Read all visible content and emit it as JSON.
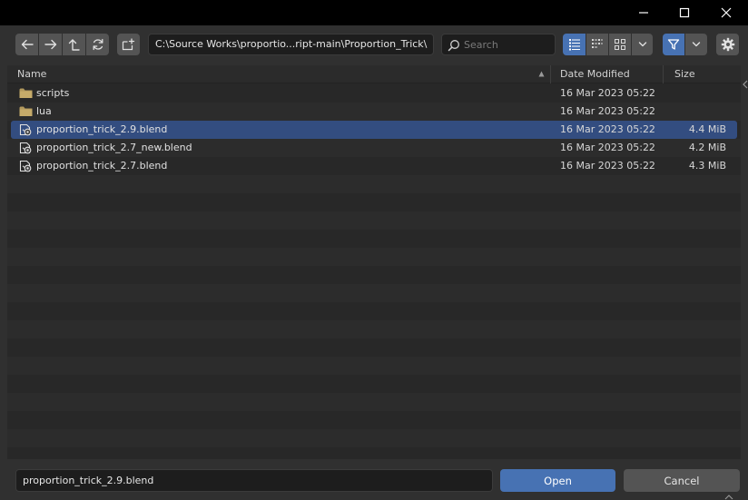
{
  "window": {
    "controls": [
      "minimize",
      "maximize",
      "close"
    ]
  },
  "toolbar": {
    "path": "C:\\Source Works\\proportio...ript-main\\Proportion_Trick\\",
    "search_placeholder": "Search",
    "icons": [
      "back-arrow",
      "forward-arrow",
      "parent-directory",
      "refresh",
      "new-folder",
      "vertical-list",
      "horizontal-list",
      "thumbnails",
      "chevron-down",
      "filter",
      "chevron-down",
      "gear"
    ]
  },
  "columns": {
    "name": "Name",
    "date": "Date Modified",
    "size": "Size"
  },
  "files": [
    {
      "name": "scripts",
      "type": "folder",
      "date": "16 Mar 2023 05:22",
      "size": ""
    },
    {
      "name": "lua",
      "type": "folder",
      "date": "16 Mar 2023 05:22",
      "size": ""
    },
    {
      "name": "proportion_trick_2.9.blend",
      "type": "blend",
      "date": "16 Mar 2023 05:22",
      "size": "4.4 MiB",
      "selected": true
    },
    {
      "name": "proportion_trick_2.7_new.blend",
      "type": "blend",
      "date": "16 Mar 2023 05:22",
      "size": "4.2 MiB"
    },
    {
      "name": "proportion_trick_2.7.blend",
      "type": "blend",
      "date": "16 Mar 2023 05:22",
      "size": "4.3 MiB"
    }
  ],
  "footer": {
    "filename": "proportion_trick_2.9.blend",
    "open_label": "Open",
    "cancel_label": "Cancel"
  },
  "colors": {
    "accent": "#4772b3",
    "selection": "#334d80",
    "folder": "#b39a5e",
    "background": "#303030"
  }
}
